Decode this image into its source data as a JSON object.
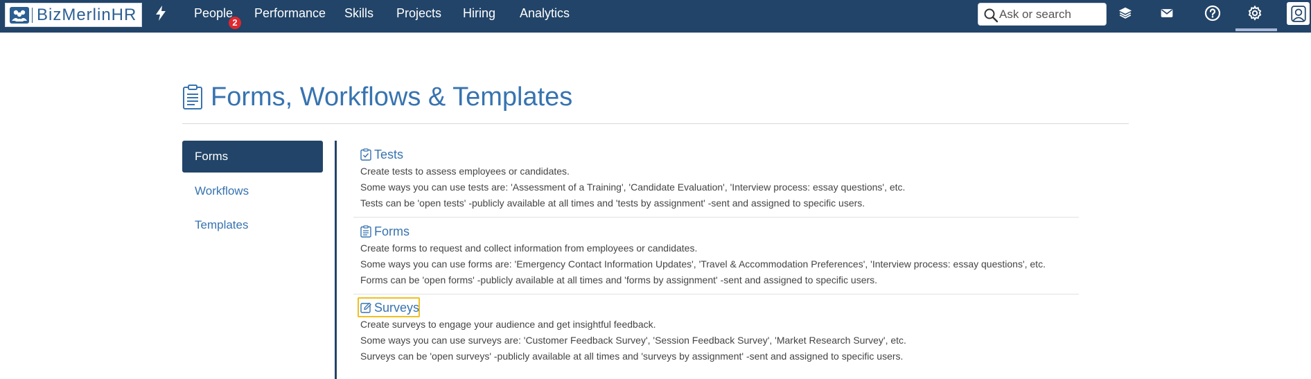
{
  "app": {
    "logo_text": "BizMerlinHR"
  },
  "nav": {
    "items": [
      {
        "label": "People",
        "badge": "2"
      },
      {
        "label": "Performance"
      },
      {
        "label": "Skills"
      },
      {
        "label": "Projects"
      },
      {
        "label": "Hiring"
      },
      {
        "label": "Analytics"
      }
    ]
  },
  "search": {
    "placeholder": "Ask or search",
    "value": ""
  },
  "top_icons": [
    "layers-icon",
    "mail-icon",
    "help-icon",
    "gear-icon",
    "user-avatar-icon"
  ],
  "page": {
    "title": "Forms, Workflows & Templates"
  },
  "sidebar": {
    "items": [
      {
        "label": "Forms",
        "active": true
      },
      {
        "label": "Workflows",
        "active": false
      },
      {
        "label": "Templates",
        "active": false
      }
    ]
  },
  "sections": [
    {
      "title": "Tests",
      "icon": "clipboard-check-icon",
      "lines": [
        "Create tests to assess employees or candidates.",
        "Some ways you can use tests are: 'Assessment of a Training', 'Candidate Evaluation', 'Interview process: essay questions', etc.",
        "Tests can be 'open tests' -publicly available at all times and 'tests by assignment' -sent and assigned to specific users."
      ]
    },
    {
      "title": "Forms",
      "icon": "clipboard-list-icon",
      "lines": [
        "Create forms to request and collect information from employees or candidates.",
        "Some ways you can use forms are: 'Emergency Contact Information Updates', 'Travel & Accommodation Preferences', 'Interview process: essay questions', etc.",
        "Forms can be 'open forms' -publicly available at all times and 'forms by assignment' -sent and assigned to specific users."
      ]
    },
    {
      "title": "Surveys",
      "icon": "edit-icon",
      "lines": [
        "Create surveys to engage your audience and get insightful feedback.",
        "Some ways you can use surveys are: 'Customer Feedback Survey', 'Session Feedback Survey', 'Market Research Survey', etc.",
        "Surveys can be 'open surveys' -publicly available at all times and 'surveys by assignment' -sent and assigned to specific users."
      ]
    }
  ],
  "colors": {
    "navbar": "#224468",
    "link": "#3773b0",
    "badge": "#e0282e",
    "highlight": "#f0c020"
  }
}
